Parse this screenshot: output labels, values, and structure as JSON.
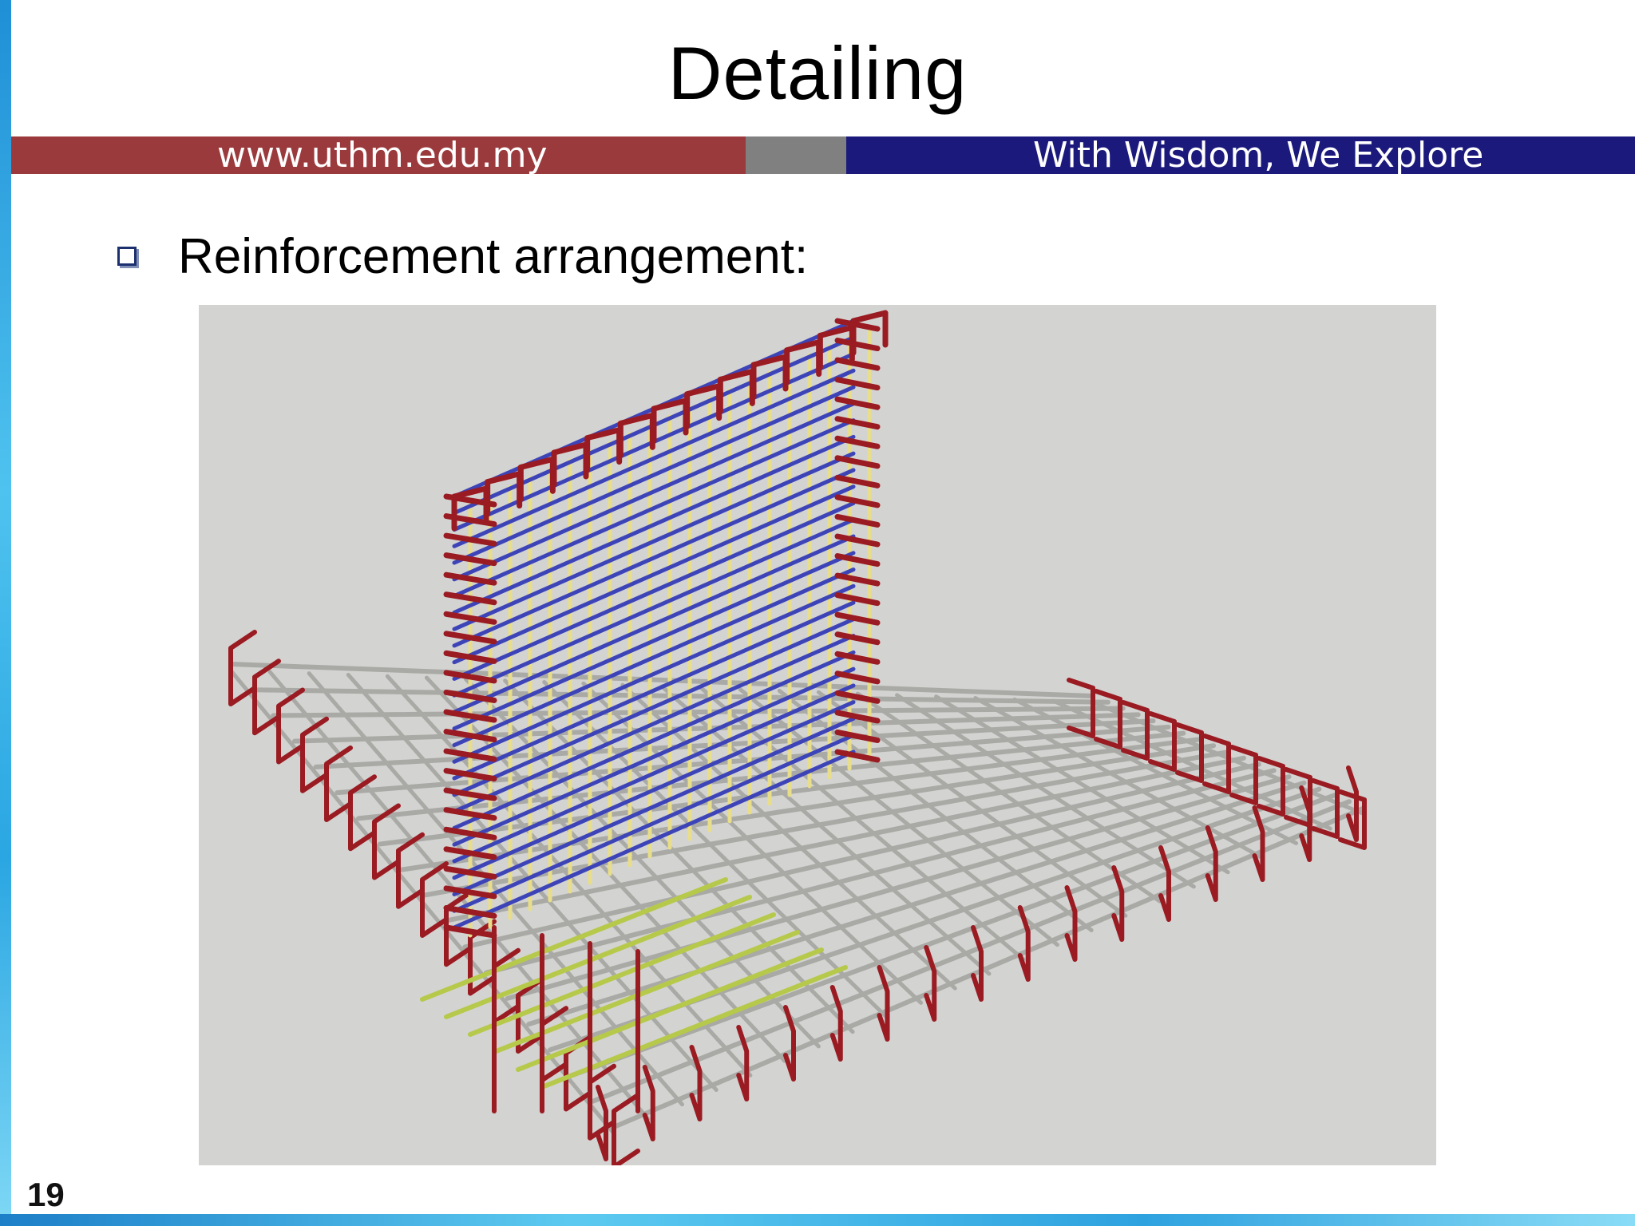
{
  "slide": {
    "title": "Detailing",
    "page_number": "19"
  },
  "banner": {
    "url": "www.uthm.edu.my",
    "motto": "With Wisdom, We Explore",
    "colors": {
      "left": "#9b3a3c",
      "middle": "#808080",
      "right": "#1b1a7c"
    }
  },
  "content": {
    "bullet": "Reinforcement arrangement:",
    "bullet_icon": "square-bullet-icon"
  },
  "figure": {
    "icon": "rebar-cage-3d-drawing",
    "colors": {
      "stirrups": "#9a1b22",
      "wall_horizontal": "#3d44b8",
      "wall_vertical": "#e8dd8a",
      "base_bars": "#a9aaa6",
      "base_secondary": "#b7c94a",
      "background": "#d3d3d1"
    }
  }
}
